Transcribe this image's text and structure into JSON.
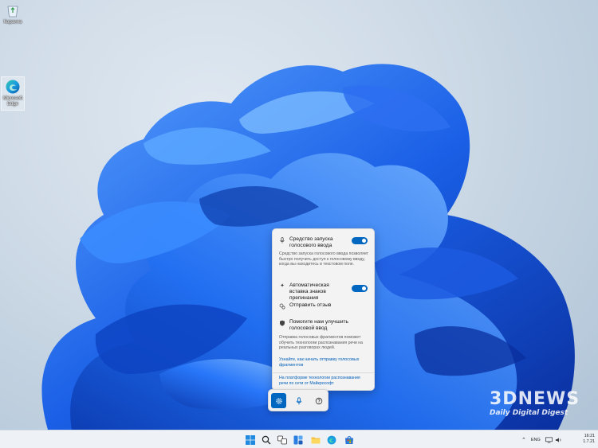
{
  "desktop": {
    "icons": [
      {
        "label": "Корзина",
        "icon": "recycle-bin-icon"
      },
      {
        "label": "Microsoft Edge",
        "icon": "edge-icon"
      }
    ]
  },
  "voice_panel": {
    "launcher": {
      "title": "Средство запуска голосового ввода",
      "enabled": true,
      "description": "Средство запуска голосового ввода позволяет быстро получить доступ к голосовому вводу, когда вы находитесь в текстовом поле."
    },
    "auto_punctuation": {
      "title": "Автоматическая вставка знаков препинания",
      "enabled": true
    },
    "feedback": {
      "title": "Отправить отзыв"
    },
    "improve": {
      "title": "Помогите нам улучшить голосовой ввод",
      "description": "Отправка голосовых фрагментов поможет обучить технологии распознавания речи на реальных разговорах людей.",
      "link": "Узнайте, как начать отправку голосовых фрагментов"
    },
    "footer": "На платформе технологии распознавания речи по сети от Майкрософт"
  },
  "mic_bar": {
    "buttons": [
      "settings-icon",
      "microphone-icon",
      "help-icon"
    ]
  },
  "watermark": {
    "logo": "3DNEWS",
    "subtitle": "Daily Digital Digest"
  },
  "taskbar": {
    "language": "ENG",
    "time": "16:21",
    "date": "1.7.21"
  },
  "colors": {
    "accent": "#0067c0",
    "bloom_dark": "#0a3fb3",
    "bloom_light": "#3a86ff"
  }
}
